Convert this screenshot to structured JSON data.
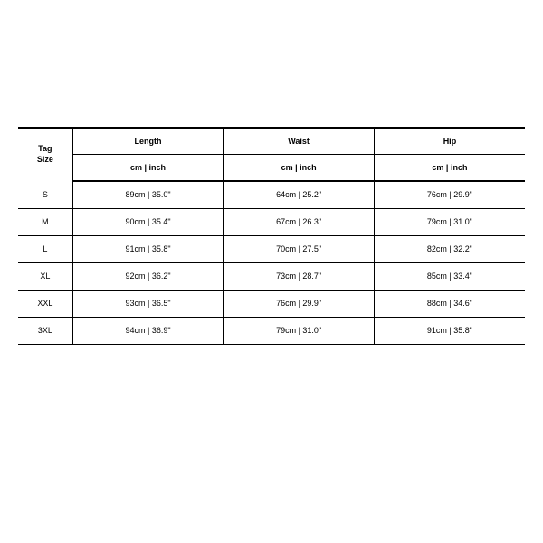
{
  "headers": {
    "tag_size_l1": "Tag",
    "tag_size_l2": "Size",
    "length": "Length",
    "waist": "Waist",
    "hip": "Hip",
    "unit": "cm | inch"
  },
  "rows": [
    {
      "size": "S",
      "length": "89cm | 35.0\"",
      "waist": "64cm | 25.2\"",
      "hip": "76cm | 29.9\""
    },
    {
      "size": "M",
      "length": "90cm | 35.4\"",
      "waist": "67cm | 26.3\"",
      "hip": "79cm | 31.0\""
    },
    {
      "size": "L",
      "length": "91cm | 35.8\"",
      "waist": "70cm | 27.5\"",
      "hip": "82cm | 32.2\""
    },
    {
      "size": "XL",
      "length": "92cm | 36.2\"",
      "waist": "73cm | 28.7\"",
      "hip": "85cm | 33.4\""
    },
    {
      "size": "XXL",
      "length": "93cm | 36.5\"",
      "waist": "76cm | 29.9\"",
      "hip": "88cm | 34.6\""
    },
    {
      "size": "3XL",
      "length": "94cm | 36.9\"",
      "waist": "79cm | 31.0\"",
      "hip": "91cm | 35.8\""
    }
  ]
}
